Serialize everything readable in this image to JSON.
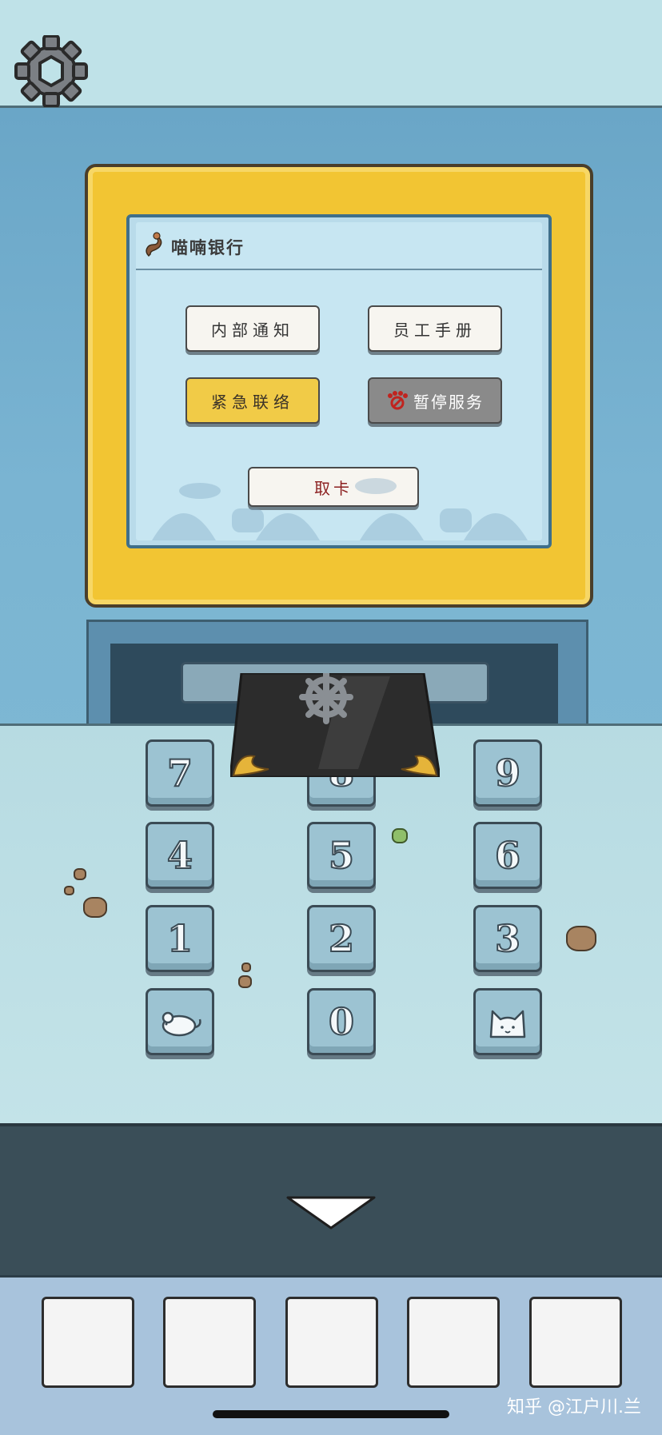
{
  "screen": {
    "bank_name": "喵喃银行",
    "menu": {
      "notice": "内部通知",
      "handbook": "员工手册",
      "emergency": "紧急联络",
      "suspend": "暂停服务",
      "withdraw_card": "取卡"
    }
  },
  "keypad": {
    "keys": [
      "7",
      "8",
      "9",
      "4",
      "5",
      "6",
      "1",
      "2",
      "3",
      "0"
    ],
    "special_keys": [
      "mouse-icon",
      "cat-icon"
    ]
  },
  "navigation": {
    "down_arrow": "chevron-down-icon"
  },
  "inventory": {
    "slot_count": 5
  },
  "watermark": "知乎 @江户川.兰",
  "colors": {
    "bezel": "#f2c533",
    "screen": "#c7e6f2",
    "wall": "#7ab4d2",
    "emergency_button": "#f1cb47",
    "suspend_button": "#8a8a8a",
    "tray": "#3a4e58",
    "inventory_bar": "#a8c3dc"
  }
}
